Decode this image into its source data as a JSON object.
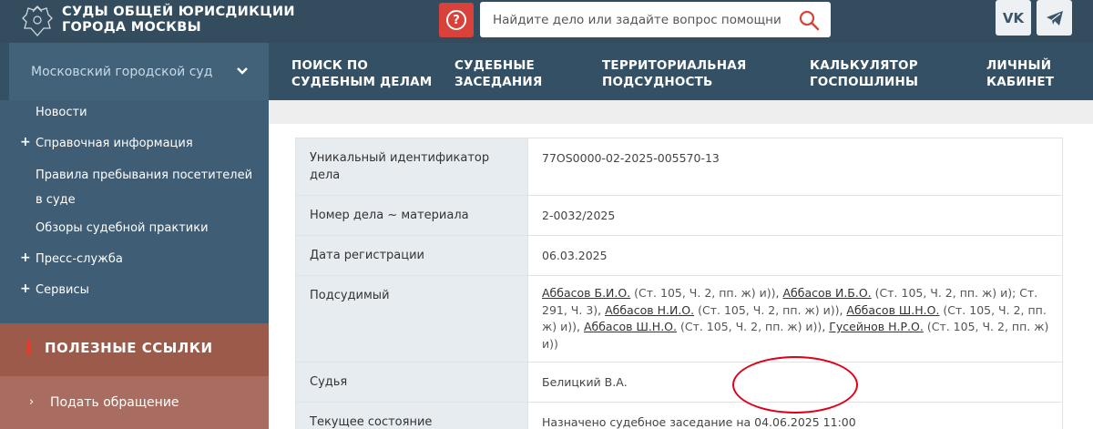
{
  "header": {
    "logo_line1": "СУДЫ ОБЩЕЙ ЮРИСДИКЦИИ",
    "logo_line2": "ГОРОДА МОСКВЫ",
    "search_placeholder": "Найдите дело или задайте вопрос помощнику",
    "vk_label": "VK"
  },
  "court_select": {
    "label": "Московский городской суд"
  },
  "nav": [
    {
      "line1": "ПОИСК ПО",
      "line2": "СУДЕБНЫМ ДЕЛАМ"
    },
    {
      "line1": "СУДЕБНЫЕ",
      "line2": "ЗАСЕДАНИЯ"
    },
    {
      "line1": "ТЕРРИТОРИАЛЬНАЯ",
      "line2": "ПОДСУДНОСТЬ"
    },
    {
      "line1": "КАЛЬКУЛЯТОР",
      "line2": "ГОСПОШЛИНЫ"
    },
    {
      "line1": "ЛИЧНЫЙ",
      "line2": "КАБИНЕТ"
    }
  ],
  "sidebar": {
    "items": [
      {
        "label": "Новости",
        "expandable": false
      },
      {
        "label": "Справочная информация",
        "expandable": true
      },
      {
        "label": "Правила пребывания посетителей",
        "label2": "в суде",
        "expandable": false
      },
      {
        "label": "Обзоры судебной практики",
        "expandable": false
      },
      {
        "label": "Пресс-служба",
        "expandable": true
      },
      {
        "label": "Сервисы",
        "expandable": true
      }
    ],
    "links_heading": "ПОЛЕЗНЫЕ ССЫЛКИ",
    "links": [
      {
        "label": "Подать обращение"
      }
    ]
  },
  "case": {
    "rows": [
      {
        "key": "Уникальный идентификатор дела",
        "value": "77OS0000-02-2025-005570-13"
      },
      {
        "key": "Номер дела ~ материала",
        "value": "2-0032/2025"
      },
      {
        "key": "Дата регистрации",
        "value": "06.03.2025"
      },
      {
        "key": "Подсудимый"
      },
      {
        "key": "Судья",
        "value": "Белицкий В.А."
      },
      {
        "key": "Текущее состояние",
        "value": "Назначено судебное заседание на 04.06.2025 11:00"
      }
    ],
    "defendants": [
      {
        "name": "Аббасов Б.И.О.",
        "article": "(Ст. 105, Ч. 2, пп. ж) и))",
        "sep": ","
      },
      {
        "name": "Аббасов И.Б.О.",
        "article": "(Ст. 105, Ч. 2, пп. ж) и); Ст. 291, Ч. 3)",
        "sep": ","
      },
      {
        "name": "Аббасов Н.И.О.",
        "article": "(Ст. 105, Ч. 2, пп. ж) и))",
        "sep": ","
      },
      {
        "name": "Аббасов Ш.Н.О.",
        "article": "(Ст. 105, Ч. 2, пп. ж) и))",
        "sep": ","
      },
      {
        "name": "Аббасов Ш.Н.О.",
        "article": "(Ст. 105, Ч. 2, пп. ж) и))",
        "sep": ","
      },
      {
        "name": "Гусейнов Н.Р.О.",
        "article": "(Ст. 105, Ч. 2, пп. ж) и))",
        "sep": ""
      }
    ]
  },
  "colors": {
    "header": "#334d5f",
    "accent_red": "#d9413b",
    "annotation": "#e0001a"
  }
}
